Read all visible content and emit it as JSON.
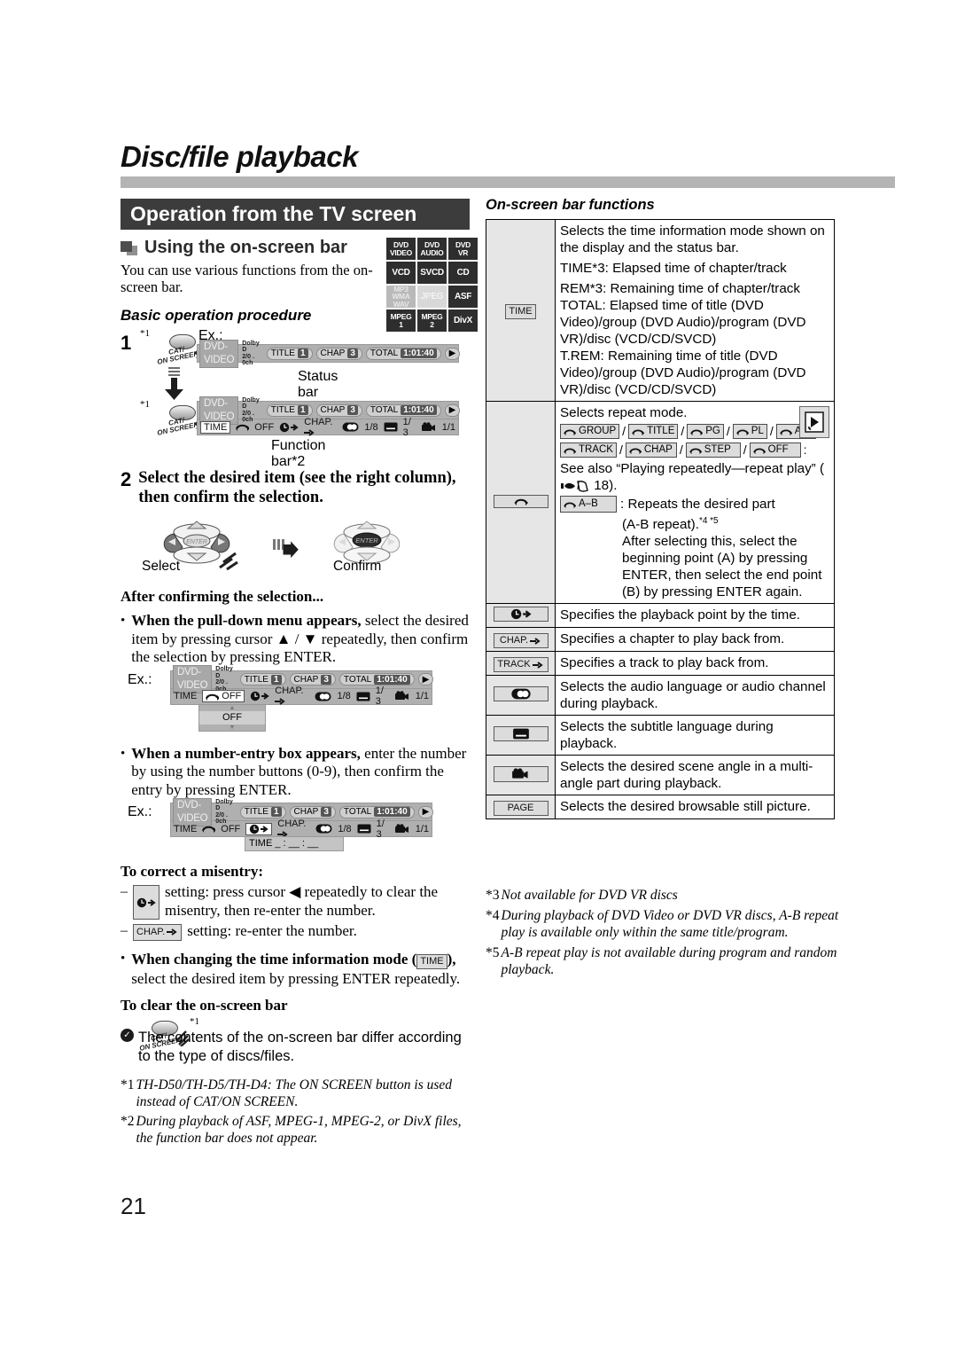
{
  "document": {
    "chapter_title": "Disc/file playback",
    "section_title": "Operation from the TV screen",
    "page_number": "21"
  },
  "left": {
    "subheading": "Using the on-screen bar",
    "intro": "You can use various functions from the on-screen bar.",
    "basic_heading": "Basic operation procedure",
    "step1": {
      "number": "1",
      "marker": "*1",
      "ex_label": "Ex.:",
      "button_label_line1": "CAT/",
      "button_label_line2": "ON SCREEN",
      "status_bar_caption": "Status bar",
      "function_bar_caption": "Function bar*2"
    },
    "step2": {
      "number": "2",
      "text": "Select the desired item (see the right column), then confirm the selection.",
      "select_label": "Select",
      "confirm_label": "Confirm",
      "enter_label": "ENTER"
    },
    "after_heading": "After confirming the selection...",
    "bullet1_bold": "When the pull-down menu appears,",
    "bullet1_rest": " select the desired item by pressing cursor ▲ / ▼ repeatedly, then confirm the selection by pressing ENTER.",
    "bullet1_ex": "Ex.:",
    "pulldown_value": "OFF",
    "bullet2_bold": "When a number-entry box appears,",
    "bullet2_rest": " enter the number by using the number buttons (0-9), then confirm the entry by pressing ENTER.",
    "bullet2_ex": "Ex.:",
    "numberbox_value": "TIME  _ : __ : __",
    "correct_heading": "To correct a misentry:",
    "correct_1": "setting: press cursor ◀ repeatedly to clear the misentry, then re-enter the number.",
    "correct_2": "setting: re-enter the number.",
    "bullet3_bold": "When changing the time information mode (",
    "bullet3_chip": "TIME",
    "bullet3_bold_end": "),",
    "bullet3_rest": "select the desired item by pressing ENTER repeatedly.",
    "clear_heading": "To clear the on-screen bar",
    "note": "The contents of the on-screen bar differ according to the type of discs/files.",
    "footnote1_marker": "*1",
    "footnote1": "TH-D50/TH-D5/TH-D4: The ON SCREEN button is used instead of CAT/ON SCREEN.",
    "footnote2_marker": "*2",
    "footnote2": "During playback of ASF, MPEG-1, MPEG-2, or DivX files, the function bar does not appear."
  },
  "disc_icons": [
    {
      "lines": [
        "DVD",
        "VIDEO"
      ],
      "style": "dark"
    },
    {
      "lines": [
        "DVD",
        "AUDIO"
      ],
      "style": "dark"
    },
    {
      "lines": [
        "DVD",
        "VR"
      ],
      "style": "dark"
    },
    {
      "lines": [
        "VCD"
      ],
      "style": "dark"
    },
    {
      "lines": [
        "SVCD"
      ],
      "style": "dark"
    },
    {
      "lines": [
        "CD"
      ],
      "style": "dark"
    },
    {
      "lines": [
        "MP3",
        "WMA",
        "WAV"
      ],
      "style": "gray"
    },
    {
      "lines": [
        "JPEG"
      ],
      "style": "gray2"
    },
    {
      "lines": [
        "ASF"
      ],
      "style": "dark"
    },
    {
      "lines": [
        "MPEG",
        "1"
      ],
      "style": "dark"
    },
    {
      "lines": [
        "MPEG",
        "2"
      ],
      "style": "dark"
    },
    {
      "lines": [
        "DivX"
      ],
      "style": "dark"
    }
  ],
  "status_bar": {
    "disc_type": "DVD-VIDEO",
    "audio_line1": "Dolby D",
    "audio_line2": "2/0 . 0ch",
    "title_key": "TITLE",
    "title_val": "1",
    "chap_key": "CHAP",
    "chap_val": "3",
    "total_key": "TOTAL",
    "total_val": "1:01:40"
  },
  "function_bar": {
    "time": "TIME",
    "repeat": "OFF",
    "chapter": "CHAP.",
    "audio": "1/8",
    "subtitle": "1/ 3",
    "angle": "1/1"
  },
  "right": {
    "heading": "On-screen bar functions",
    "rows": [
      {
        "icon": "TIME",
        "icon_kind": "text",
        "lines": [
          "Selects the time information mode shown on the display and the status bar.",
          "TIME*3: Elapsed time of chapter/track",
          "REM*3: Remaining time of chapter/track",
          "TOTAL: Elapsed time of title (DVD Video)/group (DVD Audio)/program (DVD VR)/disc (VCD/CD/SVCD)",
          "T.REM: Remaining time of title (DVD Video)/group (DVD Audio)/program (DVD VR)/disc (VCD/CD/SVCD)"
        ]
      },
      {
        "icon": "repeat",
        "icon_kind": "repeat",
        "intro": "Selects repeat mode.",
        "chips_row1": [
          "GROUP",
          "TITLE",
          "PG",
          "PL",
          "ALL"
        ],
        "chips_row2": [
          "TRACK",
          "CHAP",
          "STEP",
          "OFF"
        ],
        "see_also": "See also “Playing repeatedly—repeat play” (",
        "see_also_page": "18",
        "ab_chip": "A–B",
        "ab_text": "Repeats the desired part",
        "ab_text2": "(A-B repeat).",
        "ab_markers": "*4 *5",
        "ab_rest": "After selecting this, select the beginning point (A) by pressing ENTER, then select the end point (B) by pressing ENTER again."
      },
      {
        "icon_kind": "time-arrow",
        "text": "Specifies the playback point by the time."
      },
      {
        "icon_kind": "text-arrow",
        "icon": "CHAP.",
        "text": "Specifies a chapter to play back from."
      },
      {
        "icon_kind": "text-arrow",
        "icon": "TRACK",
        "text": "Specifies a track to play back from."
      },
      {
        "icon_kind": "audio",
        "text": "Selects the audio language or audio channel during playback."
      },
      {
        "icon_kind": "subtitle",
        "text": "Selects the subtitle language during playback."
      },
      {
        "icon_kind": "angle",
        "text": "Selects the desired scene angle in a multi-angle part during playback."
      },
      {
        "icon_kind": "text",
        "icon": "PAGE",
        "text": "Selects the desired browsable still picture."
      }
    ],
    "footnote3_marker": "*3",
    "footnote3": "Not available for DVD VR discs",
    "footnote4_marker": "*4",
    "footnote4": "During playback of DVD Video or DVD VR discs, A-B repeat play is available only within the same title/program.",
    "footnote5_marker": "*5",
    "footnote5": "A-B repeat play is not available during program and random playback."
  }
}
